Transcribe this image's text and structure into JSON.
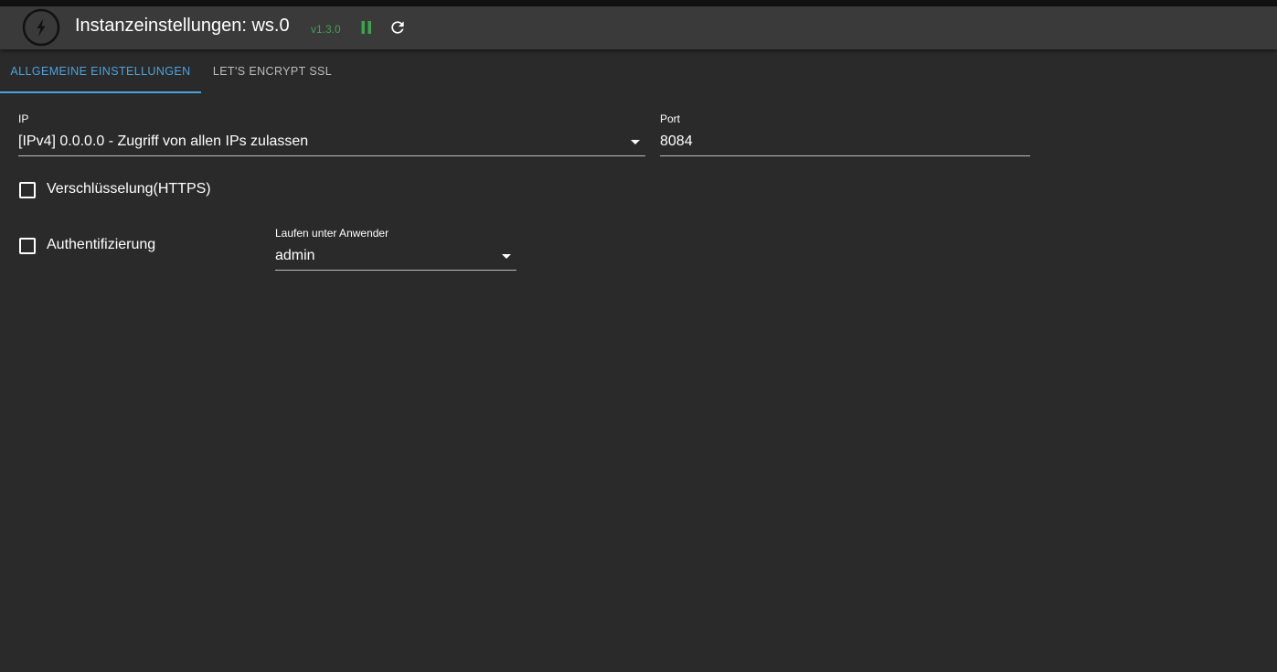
{
  "header": {
    "title": "Instanzeinstellungen: ws.0",
    "version": "v1.3.0",
    "colors": {
      "background": "#3a3a3a",
      "version": "#3fa34d",
      "pause_icon": "#3fa34d"
    },
    "icons": {
      "logo": "lightning-bolt-logo-icon",
      "pause": "pause-icon",
      "reload": "reload-icon"
    }
  },
  "tabs": [
    {
      "label": "ALLGEMEINE EINSTELLUNGEN",
      "active": true
    },
    {
      "label": "LET'S ENCRYPT SSL",
      "active": false
    }
  ],
  "accent_color": "#4aa3df",
  "form": {
    "ip": {
      "label": "IP",
      "value": "[IPv4] 0.0.0.0 - Zugriff von allen IPs zulassen"
    },
    "port": {
      "label": "Port",
      "value": "8084"
    },
    "https": {
      "label": "Verschlüsselung(HTTPS)",
      "checked": false
    },
    "auth": {
      "label": "Authentifizierung",
      "checked": false
    },
    "run_as": {
      "label": "Laufen unter Anwender",
      "value": "admin"
    }
  }
}
